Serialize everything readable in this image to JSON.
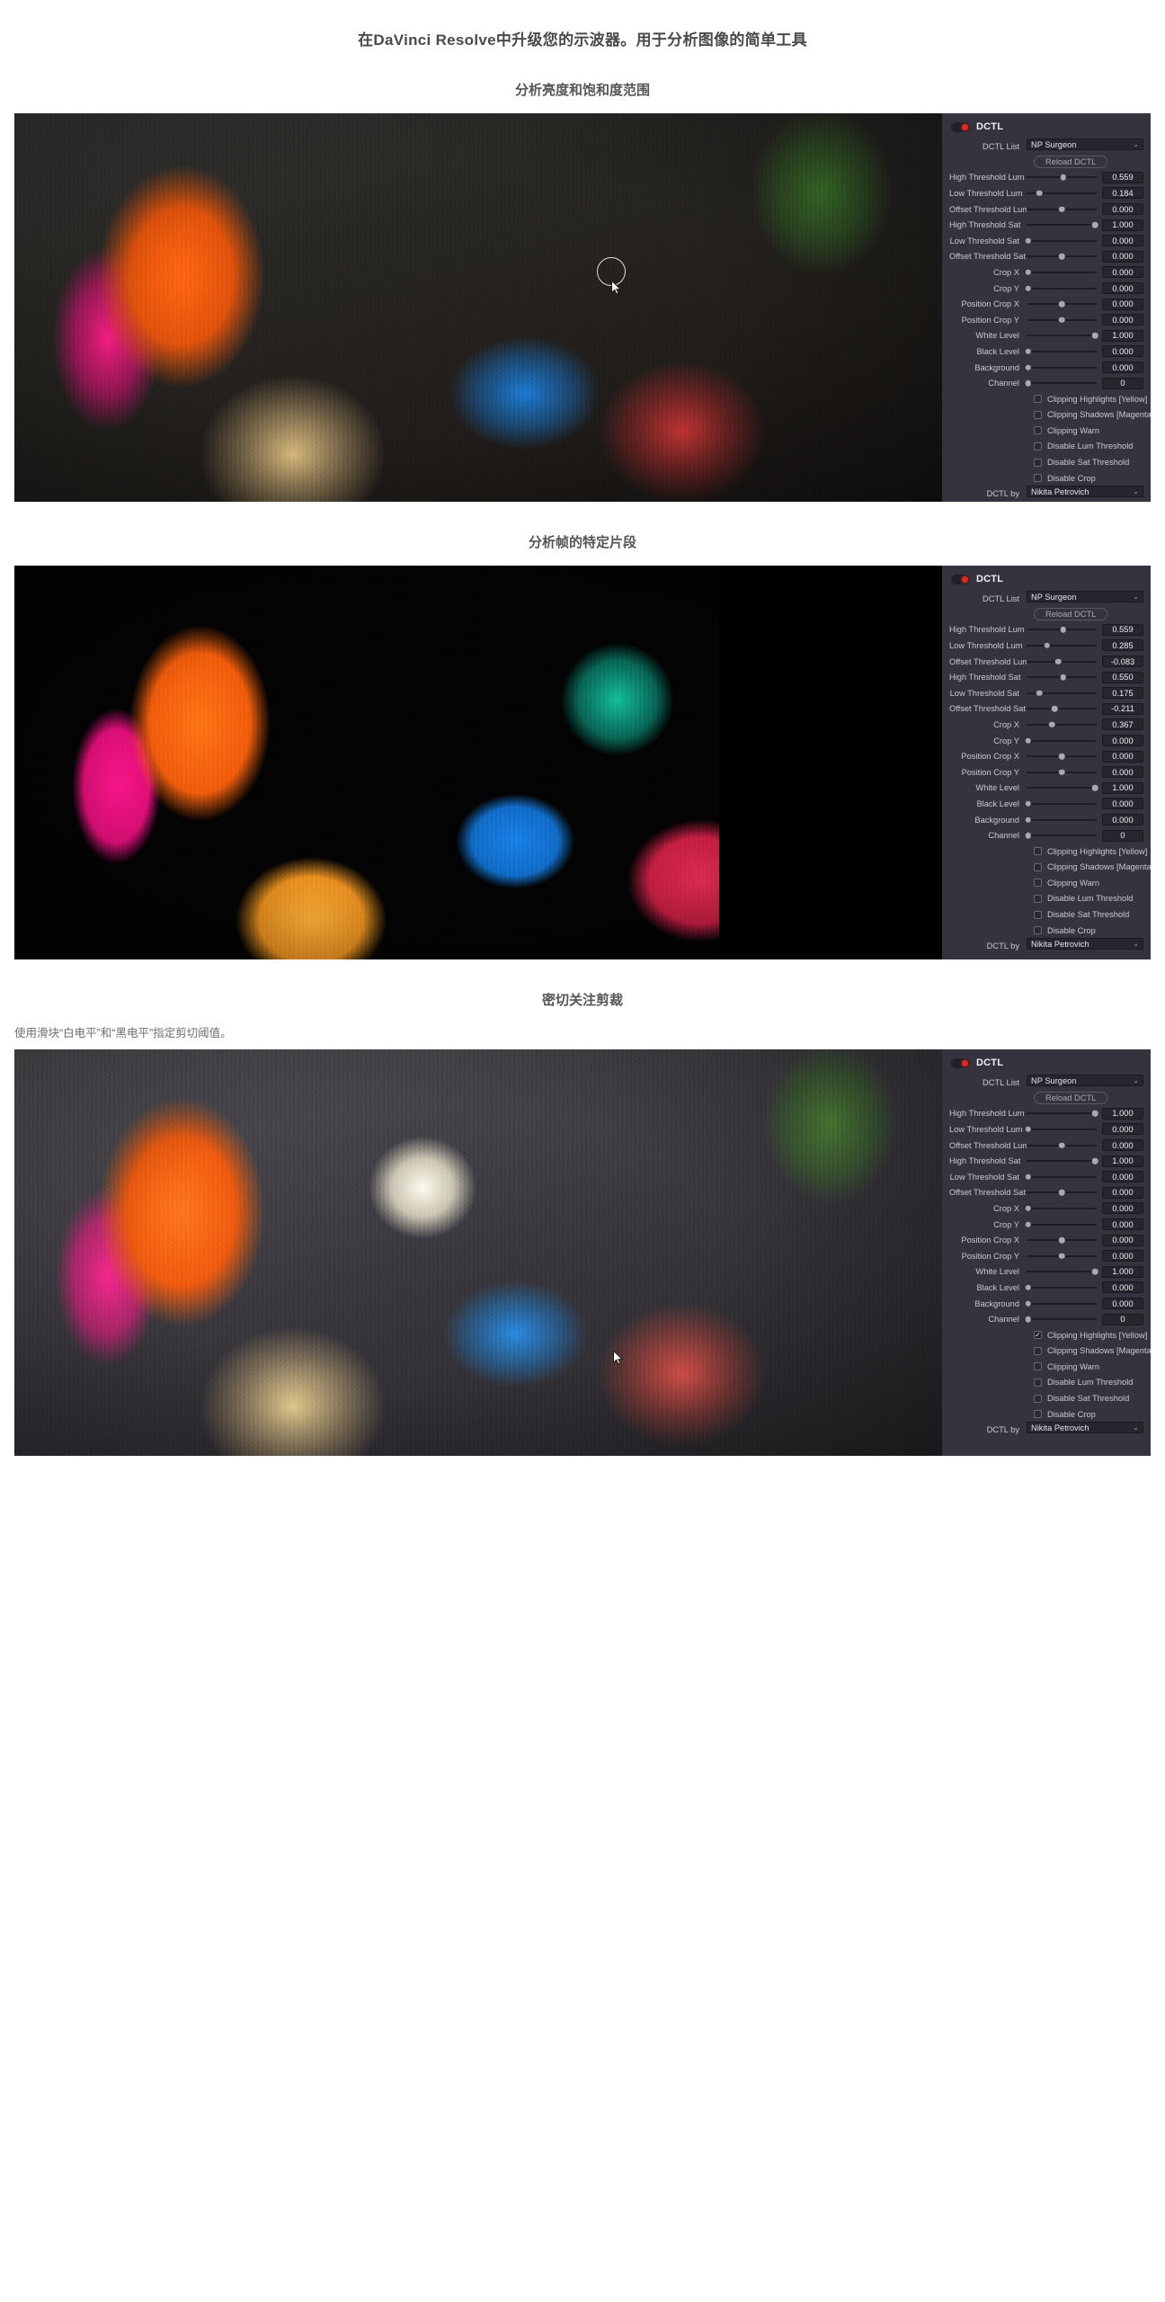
{
  "page": {
    "title": "在DaVinci Resolve中升级您的示波器。用于分析图像的简单工具"
  },
  "accent": {
    "panel_bg": "#35333e",
    "field_bg": "#27252d",
    "toggle_red": "#e02a1e",
    "text": "#c9c9d2"
  },
  "panel_common": {
    "dctl_title": "DCTL",
    "dctl_list_label": "DCTL List",
    "dctl_list_value": "NP Surgeon",
    "reload_label": "Reload DCTL",
    "dctl_by_label": "DCTL by",
    "dctl_by_value": "Nikita Petrovich",
    "chevron": "⌄",
    "check_glyph": "✓"
  },
  "sections": [
    {
      "heading": "分析亮度和饱和度范围",
      "subtitle": "",
      "panel": {
        "sliders": [
          {
            "label": "High Threshold Lum",
            "value": "0.559",
            "pos": 52
          },
          {
            "label": "Low Threshold Lum",
            "value": "0.184",
            "pos": 18
          },
          {
            "label": "Offset Threshold Lum",
            "value": "0.000",
            "pos": 50
          },
          {
            "label": "High Threshold Sat",
            "value": "1.000",
            "pos": 98
          },
          {
            "label": "Low Threshold Sat",
            "value": "0.000",
            "pos": 2
          },
          {
            "label": "Offset Threshold Sat",
            "value": "0.000",
            "pos": 50
          },
          {
            "label": "Crop X",
            "value": "0.000",
            "pos": 2
          },
          {
            "label": "Crop Y",
            "value": "0.000",
            "pos": 2
          },
          {
            "label": "Position Crop X",
            "value": "0.000",
            "pos": 50
          },
          {
            "label": "Position Crop Y",
            "value": "0.000",
            "pos": 50
          },
          {
            "label": "White Level",
            "value": "1.000",
            "pos": 98
          },
          {
            "label": "Black Level",
            "value": "0.000",
            "pos": 2
          },
          {
            "label": "Background",
            "value": "0.000",
            "pos": 2
          },
          {
            "label": "Channel",
            "value": "0",
            "pos": 2
          }
        ],
        "checkboxes": [
          {
            "label": "Clipping Highlights [Yellow]",
            "checked": false
          },
          {
            "label": "Clipping Shadows [Magenta]",
            "checked": false
          },
          {
            "label": "Clipping Warn",
            "checked": false
          },
          {
            "label": "Disable Lum Threshold",
            "checked": false
          },
          {
            "label": "Disable Sat Threshold",
            "checked": false
          },
          {
            "label": "Disable Crop",
            "checked": false
          }
        ]
      }
    },
    {
      "heading": "分析帧的特定片段",
      "subtitle": "",
      "panel": {
        "sliders": [
          {
            "label": "High Threshold Lum",
            "value": "0.559",
            "pos": 52
          },
          {
            "label": "Low Threshold Lum",
            "value": "0.285",
            "pos": 29
          },
          {
            "label": "Offset Threshold Lum",
            "value": "-0.083",
            "pos": 45
          },
          {
            "label": "High Threshold Sat",
            "value": "0.550",
            "pos": 52
          },
          {
            "label": "Low Threshold Sat",
            "value": "0.175",
            "pos": 18
          },
          {
            "label": "Offset Threshold Sat",
            "value": "-0.211",
            "pos": 40
          },
          {
            "label": "Crop X",
            "value": "0.367",
            "pos": 36
          },
          {
            "label": "Crop Y",
            "value": "0.000",
            "pos": 2
          },
          {
            "label": "Position Crop X",
            "value": "0.000",
            "pos": 50
          },
          {
            "label": "Position Crop Y",
            "value": "0.000",
            "pos": 50
          },
          {
            "label": "White Level",
            "value": "1.000",
            "pos": 98
          },
          {
            "label": "Black Level",
            "value": "0.000",
            "pos": 2
          },
          {
            "label": "Background",
            "value": "0.000",
            "pos": 2
          },
          {
            "label": "Channel",
            "value": "0",
            "pos": 2
          }
        ],
        "checkboxes": [
          {
            "label": "Clipping Highlights [Yellow]",
            "checked": false
          },
          {
            "label": "Clipping Shadows [Magenta]",
            "checked": false
          },
          {
            "label": "Clipping Warn",
            "checked": false
          },
          {
            "label": "Disable Lum Threshold",
            "checked": false
          },
          {
            "label": "Disable Sat Threshold",
            "checked": false
          },
          {
            "label": "Disable Crop",
            "checked": false
          }
        ]
      }
    },
    {
      "heading": "密切关注剪裁",
      "subtitle": "使用滑块“白电平”和“黑电平”指定剪切阈值。",
      "panel": {
        "sliders": [
          {
            "label": "High Threshold Lum",
            "value": "1.000",
            "pos": 98
          },
          {
            "label": "Low Threshold Lum",
            "value": "0.000",
            "pos": 2
          },
          {
            "label": "Offset Threshold Lum",
            "value": "0.000",
            "pos": 50
          },
          {
            "label": "High Threshold Sat",
            "value": "1.000",
            "pos": 98
          },
          {
            "label": "Low Threshold Sat",
            "value": "0.000",
            "pos": 2
          },
          {
            "label": "Offset Threshold Sat",
            "value": "0.000",
            "pos": 50
          },
          {
            "label": "Crop X",
            "value": "0.000",
            "pos": 2
          },
          {
            "label": "Crop Y",
            "value": "0.000",
            "pos": 2
          },
          {
            "label": "Position Crop X",
            "value": "0.000",
            "pos": 50
          },
          {
            "label": "Position Crop Y",
            "value": "0.000",
            "pos": 50
          },
          {
            "label": "White Level",
            "value": "1.000",
            "pos": 98
          },
          {
            "label": "Black Level",
            "value": "0.000",
            "pos": 2
          },
          {
            "label": "Background",
            "value": "0.000",
            "pos": 2
          },
          {
            "label": "Channel",
            "value": "0",
            "pos": 2
          }
        ],
        "checkboxes": [
          {
            "label": "Clipping Highlights [Yellow]",
            "checked": true
          },
          {
            "label": "Clipping Shadows [Magenta]",
            "checked": false
          },
          {
            "label": "Clipping Warn",
            "checked": false
          },
          {
            "label": "Disable Lum Threshold",
            "checked": false
          },
          {
            "label": "Disable Sat Threshold",
            "checked": false
          },
          {
            "label": "Disable Crop",
            "checked": false
          }
        ]
      }
    }
  ]
}
